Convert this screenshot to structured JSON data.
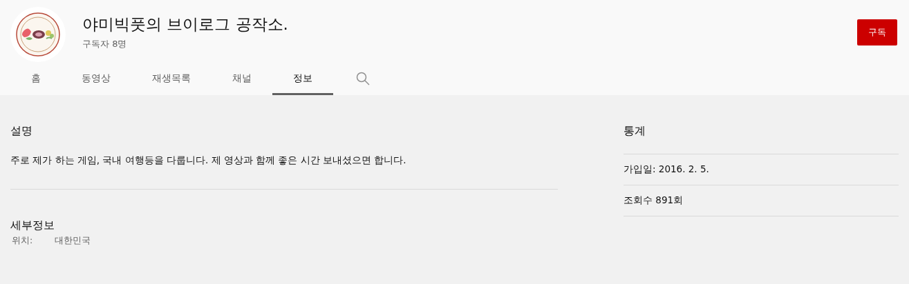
{
  "channel": {
    "title": "야미빅풋의 브이로그 공작소.",
    "subscribers": "구독자 8명",
    "subscribe_button": "구독"
  },
  "tabs": [
    {
      "label": "홈",
      "selected": false
    },
    {
      "label": "동영상",
      "selected": false
    },
    {
      "label": "재생목록",
      "selected": false
    },
    {
      "label": "채널",
      "selected": false
    },
    {
      "label": "정보",
      "selected": true
    }
  ],
  "description": {
    "heading": "설명",
    "text": "주로 제가 하는 게임, 국내 여행등을 다룹니다. 제 영상과 함께 좋은 시간 보내셨으면 합니다."
  },
  "details": {
    "heading": "세부정보",
    "rows": [
      {
        "label": "위치:",
        "value": "대한민국"
      }
    ]
  },
  "stats": {
    "heading": "통계",
    "items": [
      "가입일: 2016. 2. 5.",
      "조회수 891회"
    ]
  }
}
